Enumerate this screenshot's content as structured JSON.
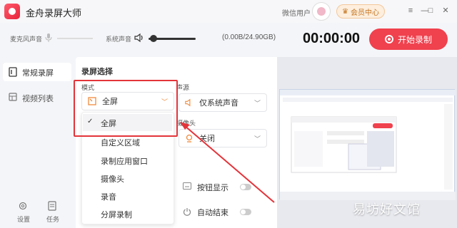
{
  "app": {
    "title": "金舟录屏大师",
    "user_label": "微信用户",
    "vip_label": "会员中心"
  },
  "window_controls": {
    "menu": "≡",
    "minimize": "—",
    "maximize": "□",
    "close": "✕"
  },
  "audio": {
    "mic_label": "麦克风声音",
    "system_label": "系统声音",
    "storage": "(0.00B/24.90GB)"
  },
  "timer": "00:00:00",
  "start_button": "开始录制",
  "sidebar": {
    "items": [
      {
        "label": "常规录屏",
        "active": true
      },
      {
        "label": "视频列表",
        "active": false
      }
    ],
    "bottom": [
      {
        "label": "设置"
      },
      {
        "label": "任务"
      }
    ]
  },
  "recording": {
    "section_title": "录屏选择",
    "mode_label": "模式",
    "mode_value": "全屏",
    "mode_options": [
      "全屏",
      "自定义区域",
      "录制应用窗口",
      "摄像头",
      "录音",
      "分屏录制"
    ],
    "audio_label": "声源",
    "audio_value": "仅系统声音",
    "camera_label": "摄像头",
    "camera_value": "关闭",
    "button_display_label": "按钮显示",
    "button_display_on": false,
    "auto_end_label": "自动结束",
    "auto_end_on": false
  },
  "colors": {
    "accent": "#f0414e",
    "highlight_box": "#e3343a",
    "arrow": "#e3343a"
  },
  "watermark": "易坊好文馆"
}
